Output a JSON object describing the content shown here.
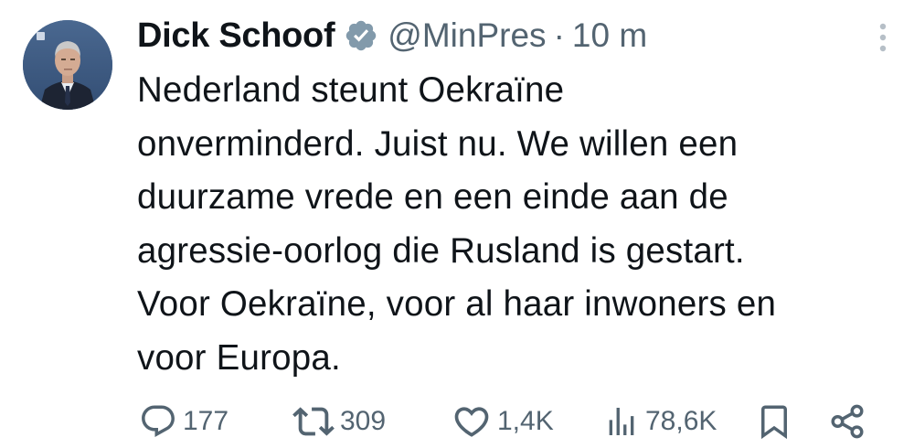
{
  "author": {
    "name": "Dick Schoof",
    "handle": "@MinPres",
    "separator": "·",
    "time": "10 m",
    "verified": true,
    "avatar_icon": "person-portrait-avatar"
  },
  "tweet": {
    "text": "Nederland steunt Oekraïne\nonverminderd. Juist nu. We willen een\nduurzame vrede en een einde aan de\nagressie-oorlog die Rusland is gestart.\nVoor Oekraïne, voor al haar inwoners en\nvoor Europa."
  },
  "actions": {
    "reply": {
      "icon": "reply-icon",
      "count": "177"
    },
    "repost": {
      "icon": "repost-icon",
      "count": "309"
    },
    "like": {
      "icon": "heart-icon",
      "count": "1,4K"
    },
    "views": {
      "icon": "views-icon",
      "count": "78,6K"
    },
    "bookmark": {
      "icon": "bookmark-icon"
    },
    "share": {
      "icon": "share-icon"
    }
  },
  "colors": {
    "text": "#0f1419",
    "secondary": "#536471",
    "verified_badge": "#829aab",
    "avatar_bg": "#3f5d86"
  }
}
